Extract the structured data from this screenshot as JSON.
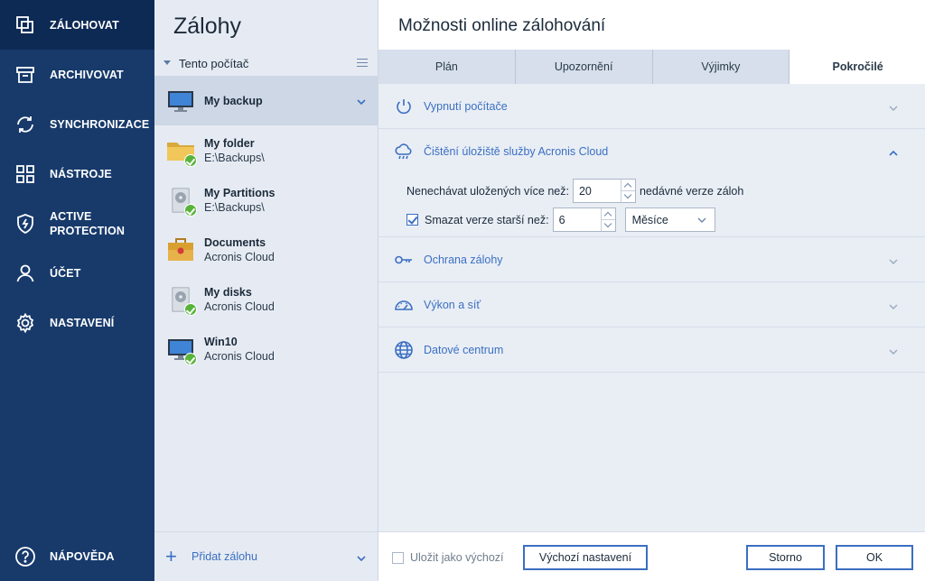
{
  "nav": {
    "items": [
      {
        "label": "ZÁLOHOVAT",
        "icon": "copy-icon"
      },
      {
        "label": "ARCHIVOVAT",
        "icon": "archive-box-icon"
      },
      {
        "label": "SYNCHRONIZACE",
        "icon": "sync-icon"
      },
      {
        "label": "NÁSTROJE",
        "icon": "grid-icon"
      },
      {
        "label": "ACTIVE PROTECTION",
        "icon": "shield-bolt-icon"
      },
      {
        "label": "ÚČET",
        "icon": "user-icon"
      },
      {
        "label": "NASTAVENÍ",
        "icon": "gear-icon"
      }
    ],
    "help": {
      "label": "NÁPOVĚDA",
      "icon": "question-icon"
    }
  },
  "list": {
    "title": "Zálohy",
    "group": "Tento počítač",
    "items": [
      {
        "name": "My backup",
        "sub": "",
        "icon": "monitor-icon"
      },
      {
        "name": "My folder",
        "sub": "E:\\Backups\\",
        "icon": "folder-icon"
      },
      {
        "name": "My Partitions",
        "sub": "E:\\Backups\\",
        "icon": "disk-icon"
      },
      {
        "name": "Documents",
        "sub": "Acronis Cloud",
        "icon": "briefcase-icon"
      },
      {
        "name": "My disks",
        "sub": "Acronis Cloud",
        "icon": "disk-icon"
      },
      {
        "name": "Win10",
        "sub": "Acronis Cloud",
        "icon": "monitor-icon"
      }
    ],
    "add_label": "Přidat zálohu"
  },
  "panel": {
    "title": "Možnosti online zálohování",
    "tabs": [
      "Plán",
      "Upozornění",
      "Výjimky",
      "Pokročilé"
    ],
    "active_tab": "Pokročilé",
    "sections": [
      {
        "label": "Vypnutí počítače",
        "icon": "power-icon"
      },
      {
        "label": "Čištění úložiště služby Acronis Cloud",
        "icon": "cloud-rain-icon"
      },
      {
        "label": "Ochrana zálohy",
        "icon": "key-icon"
      },
      {
        "label": "Výkon a síť",
        "icon": "gauge-icon"
      },
      {
        "label": "Datové centrum",
        "icon": "globe-icon"
      }
    ],
    "cleanup": {
      "keep_prefix": "Nenechávat uložených více než:",
      "keep_value": "20",
      "keep_suffix": "nedávné verze záloh",
      "delete_label": "Smazat verze starší než:",
      "delete_checked": true,
      "delete_value": "6",
      "unit": "Měsíce"
    },
    "footer": {
      "save_default": "Uložit jako výchozí",
      "defaults_button": "Výchozí nastavení",
      "cancel_button": "Storno",
      "ok_button": "OK"
    }
  },
  "colors": {
    "nav_bg": "#173a6b",
    "nav_active": "#0d2a55",
    "accent": "#3b6fc1",
    "ok_badge": "#58b33a"
  }
}
